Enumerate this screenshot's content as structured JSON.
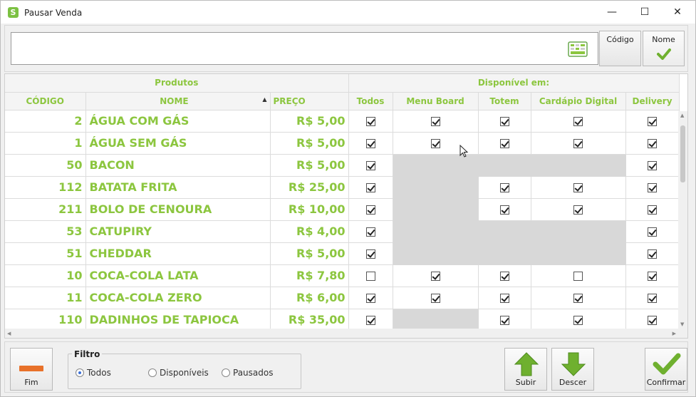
{
  "window": {
    "title": "Pausar Venda",
    "minimize": "—",
    "maximize": "☐",
    "close": "✕"
  },
  "search": {
    "value": "",
    "btn_codigo": "Código",
    "btn_nome": "Nome"
  },
  "grid": {
    "band_produtos": "Produtos",
    "band_disponivel": "Disponível em:",
    "columns": {
      "codigo": "CÓDIGO",
      "nome": "NOME",
      "preco": "PREÇO",
      "todos": "Todos",
      "menu_board": "Menu Board",
      "totem": "Totem",
      "cardapio": "Cardápio Digital",
      "delivery": "Delivery"
    },
    "rows": [
      {
        "code": "2",
        "name": "ÁGUA COM GÁS",
        "price": "R$ 5,00",
        "todos": true,
        "menu": true,
        "totem": true,
        "cardapio": true,
        "delivery": true
      },
      {
        "code": "1",
        "name": "ÁGUA SEM GÁS",
        "price": "R$ 5,00",
        "todos": true,
        "menu": true,
        "totem": true,
        "cardapio": true,
        "delivery": true
      },
      {
        "code": "50",
        "name": "BACON",
        "price": "R$ 5,00",
        "todos": true,
        "menu": null,
        "totem": null,
        "cardapio": null,
        "delivery": true
      },
      {
        "code": "112",
        "name": "BATATA FRITA",
        "price": "R$ 25,00",
        "todos": true,
        "menu": null,
        "totem": true,
        "cardapio": true,
        "delivery": true
      },
      {
        "code": "211",
        "name": "BOLO DE CENOURA",
        "price": "R$ 10,00",
        "todos": true,
        "menu": null,
        "totem": true,
        "cardapio": true,
        "delivery": true
      },
      {
        "code": "53",
        "name": "CATUPIRY",
        "price": "R$ 4,00",
        "todos": true,
        "menu": null,
        "totem": null,
        "cardapio": null,
        "delivery": true
      },
      {
        "code": "51",
        "name": "CHEDDAR",
        "price": "R$ 5,00",
        "todos": true,
        "menu": null,
        "totem": null,
        "cardapio": null,
        "delivery": true
      },
      {
        "code": "10",
        "name": "COCA-COLA LATA",
        "price": "R$ 7,80",
        "todos": false,
        "menu": true,
        "totem": true,
        "cardapio": false,
        "delivery": true
      },
      {
        "code": "11",
        "name": "COCA-COLA ZERO",
        "price": "R$ 6,00",
        "todos": true,
        "menu": true,
        "totem": true,
        "cardapio": true,
        "delivery": true
      },
      {
        "code": "110",
        "name": "DADINHOS DE TAPIOCA",
        "price": "R$ 35,00",
        "todos": true,
        "menu": null,
        "totem": true,
        "cardapio": true,
        "delivery": true
      }
    ]
  },
  "bottom": {
    "fim": "Fim",
    "filtro_legend": "Filtro",
    "filtro_options": [
      "Todos",
      "Disponíveis",
      "Pausados"
    ],
    "filtro_selected": "Todos",
    "subir": "Subir",
    "descer": "Descer",
    "confirmar": "Confirmar"
  },
  "colors": {
    "accent_green": "#8cc63f",
    "disabled_cell": "#d8d8d8",
    "fim_bar": "#e8712a"
  }
}
